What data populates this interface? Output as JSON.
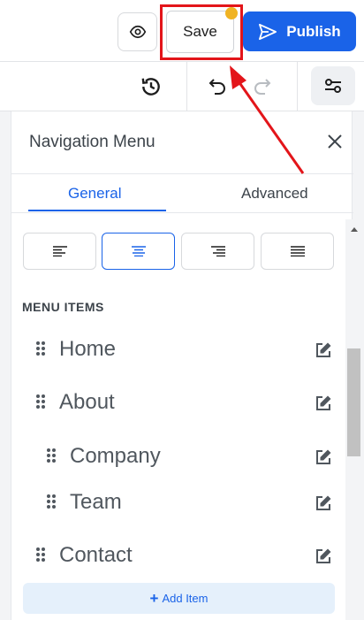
{
  "topbar": {
    "preview_icon": "eye-icon",
    "save_label": "Save",
    "publish_label": "Publish",
    "publish_icon": "send-icon"
  },
  "toolbar": {
    "icons": [
      "revision-history-icon",
      "undo-icon",
      "redo-icon",
      "settings-sliders-icon"
    ]
  },
  "panel": {
    "title": "Navigation Menu",
    "close_icon": "close-icon",
    "tabs": [
      {
        "label": "General",
        "active": true
      },
      {
        "label": "Advanced",
        "active": false
      }
    ],
    "alignment": {
      "options": [
        "align-left-icon",
        "align-center-icon",
        "align-right-icon",
        "align-justify-icon"
      ],
      "selected": "center"
    },
    "section_label": "MENU ITEMS",
    "items": [
      {
        "label": "Home",
        "level": 0
      },
      {
        "label": "About",
        "level": 0
      },
      {
        "label": "Company",
        "level": 1
      },
      {
        "label": "Team",
        "level": 1
      },
      {
        "label": "Contact",
        "level": 0
      }
    ],
    "add_item_label": "Add Item"
  },
  "colors": {
    "accent": "#1a63e8",
    "highlight": "#e3151a",
    "unsaved_dot": "#f0b323"
  }
}
